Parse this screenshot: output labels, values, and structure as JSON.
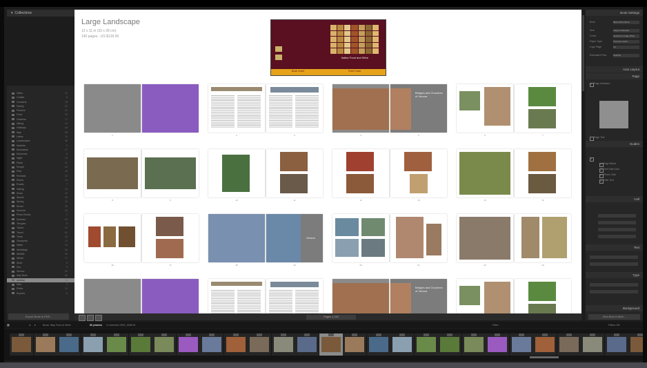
{
  "left_panel": {
    "header": "Collections",
    "collections": [
      {
        "label": "Cities",
        "count": "12"
      },
      {
        "label": "Coasts",
        "count": "8"
      },
      {
        "label": "Concerts",
        "count": "15"
      },
      {
        "label": "Family",
        "count": "22"
      },
      {
        "label": "Flowers",
        "count": "31"
      },
      {
        "label": "Food",
        "count": "19"
      },
      {
        "label": "Gardens",
        "count": "17"
      },
      {
        "label": "Hiking",
        "count": "24"
      },
      {
        "label": "Holidays",
        "count": "40"
      },
      {
        "label": "Italy",
        "count": "58"
      },
      {
        "label": "Lakes",
        "count": "11"
      },
      {
        "label": "Landscapes",
        "count": "36"
      },
      {
        "label": "Markets",
        "count": "9"
      },
      {
        "label": "Mountains",
        "count": "27"
      },
      {
        "label": "Museums",
        "count": "6"
      },
      {
        "label": "Night",
        "count": "13"
      },
      {
        "label": "Parks",
        "count": "21"
      },
      {
        "label": "People",
        "count": "44"
      },
      {
        "label": "Pets",
        "count": "18"
      },
      {
        "label": "Portraits",
        "count": "32"
      },
      {
        "label": "Rivers",
        "count": "10"
      },
      {
        "label": "Roads",
        "count": "7"
      },
      {
        "label": "Sailing",
        "count": "14"
      },
      {
        "label": "Snow",
        "count": "12"
      },
      {
        "label": "Sports",
        "count": "25"
      },
      {
        "label": "Spring",
        "count": "16"
      },
      {
        "label": "Street",
        "count": "29"
      },
      {
        "label": "Summer",
        "count": "33"
      },
      {
        "label": "Photo Books",
        "count": "2"
      },
      {
        "label": "Sunsets",
        "count": "20"
      },
      {
        "label": "Temples",
        "count": "5"
      },
      {
        "label": "Towns",
        "count": "23"
      },
      {
        "label": "Travel",
        "count": "61"
      },
      {
        "label": "Trees",
        "count": "15"
      },
      {
        "label": "Vineyards",
        "count": "12"
      },
      {
        "label": "Water",
        "count": "19"
      },
      {
        "label": "Weddings",
        "count": "48"
      },
      {
        "label": "Wildlife",
        "count": "26"
      },
      {
        "label": "Winter",
        "count": "17"
      },
      {
        "label": "Work",
        "count": "8"
      },
      {
        "label": "Zoo",
        "count": "9"
      },
      {
        "label": "Verona",
        "count": "60"
      },
      {
        "label": "Italy Book",
        "count": "60"
      },
      {
        "label": "Archive",
        "count": "14"
      },
      {
        "label": "Misc",
        "count": "3"
      },
      {
        "label": "Prints",
        "count": "12"
      },
      {
        "label": "Exports",
        "count": "6"
      }
    ],
    "selected_index": 43,
    "button_label": "Export Book to PDF..."
  },
  "book": {
    "title": "Large Landscape",
    "dimensions": "13 x 11 in (33 x 28 cm)",
    "pricing": "140 pages - US $139.99",
    "cover_title": "Italian Food and Wine",
    "cover_spine_left": "Book Cover",
    "cover_spine_right": "Front Cover",
    "spread_caption_1": "Bridges and Churches of Verona",
    "spread_caption_2": "Verona"
  },
  "page_numbers": [
    [
      "1",
      ""
    ],
    [
      "2",
      "3"
    ],
    [
      "4",
      "5"
    ],
    [
      "6",
      "7"
    ],
    [
      "8",
      "9"
    ],
    [
      "10",
      "11"
    ],
    [
      "12",
      "13"
    ],
    [
      "14",
      "15"
    ],
    [
      "16",
      "17"
    ],
    [
      "18",
      "19"
    ],
    [
      "20",
      "21"
    ],
    [
      "22",
      "23"
    ]
  ],
  "right_panel": {
    "headers": [
      "Book Settings",
      "Auto Layout",
      "Page",
      "Guides",
      "Cell",
      "Text",
      "Type",
      "Background"
    ],
    "book_settings_rows": [
      "Book",
      "Size",
      "Cover",
      "Paper Type",
      "Logo Page",
      "Estimated Price"
    ],
    "book_settings_values": [
      "Blurb Photo Book",
      "Large Landscape",
      "Hardcover Image Wrap",
      "Premium Lustre",
      "On",
      "$139.99"
    ],
    "page_labels": [
      "Page Numbers",
      "Page Text"
    ],
    "guides": [
      "Page Bleed",
      "Text Safe Area",
      "Photo Cells",
      "Filler Text"
    ],
    "button_label": "Send Book to Blurb..."
  },
  "toolbar": {
    "pager": "Pages 1-140"
  },
  "filmstrip_bar": {
    "source": "Book: Italy Food & Wine",
    "count": "60 photos",
    "selected": "/1 selected /IMG_3250.tif",
    "filter_label": "Filter:",
    "filter_value": "Filters Off"
  },
  "colors": {
    "accent_cover": "#5a1020",
    "cover_band": "#e6a21a",
    "panel_bg": "#262626",
    "selected_row": "#8a8a8a"
  }
}
